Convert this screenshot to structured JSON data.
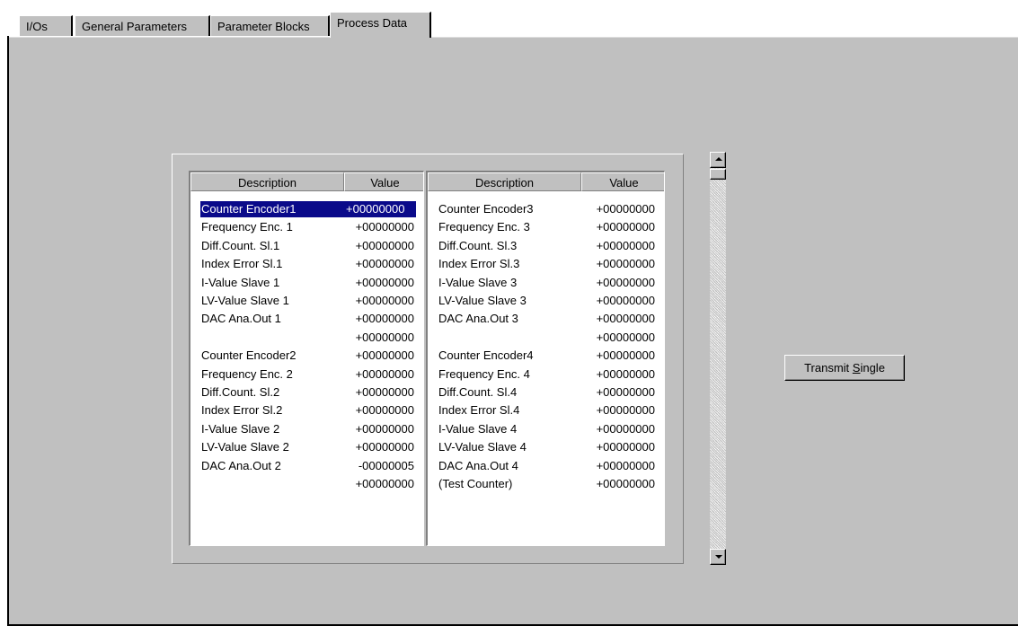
{
  "tabs": [
    {
      "label": "I/Os"
    },
    {
      "label": "General Parameters"
    },
    {
      "label": "Parameter Blocks"
    },
    {
      "label": "Process Data",
      "active": true
    }
  ],
  "left_table": {
    "headers": {
      "description": "Description",
      "value": "Value"
    },
    "rows": [
      {
        "description": "Counter Encoder1",
        "value": "+00000000",
        "selected": true
      },
      {
        "description": "Frequency Enc. 1",
        "value": "+00000000"
      },
      {
        "description": "Diff.Count. Sl.1",
        "value": "+00000000"
      },
      {
        "description": "Index Error Sl.1",
        "value": "+00000000"
      },
      {
        "description": "I-Value Slave 1",
        "value": "+00000000"
      },
      {
        "description": "LV-Value Slave 1",
        "value": "+00000000"
      },
      {
        "description": "DAC Ana.Out 1",
        "value": "+00000000"
      },
      {
        "description": "",
        "value": "+00000000"
      },
      {
        "description": "Counter Encoder2",
        "value": "+00000000"
      },
      {
        "description": "Frequency Enc. 2",
        "value": "+00000000"
      },
      {
        "description": "Diff.Count. Sl.2",
        "value": "+00000000"
      },
      {
        "description": "Index Error Sl.2",
        "value": "+00000000"
      },
      {
        "description": "I-Value Slave 2",
        "value": "+00000000"
      },
      {
        "description": "LV-Value Slave 2",
        "value": "+00000000"
      },
      {
        "description": "DAC Ana.Out 2",
        "value": "-00000005"
      },
      {
        "description": "",
        "value": "+00000000"
      }
    ]
  },
  "right_table": {
    "headers": {
      "description": "Description",
      "value": "Value"
    },
    "rows": [
      {
        "description": "Counter Encoder3",
        "value": "+00000000"
      },
      {
        "description": "Frequency Enc. 3",
        "value": "+00000000"
      },
      {
        "description": "Diff.Count. Sl.3",
        "value": "+00000000"
      },
      {
        "description": "Index Error Sl.3",
        "value": "+00000000"
      },
      {
        "description": "I-Value Slave 3",
        "value": "+00000000"
      },
      {
        "description": "LV-Value Slave 3",
        "value": "+00000000"
      },
      {
        "description": "DAC Ana.Out 3",
        "value": "+00000000"
      },
      {
        "description": "",
        "value": "+00000000"
      },
      {
        "description": "Counter Encoder4",
        "value": "+00000000"
      },
      {
        "description": "Frequency Enc. 4",
        "value": "+00000000"
      },
      {
        "description": "Diff.Count. Sl.4",
        "value": "+00000000"
      },
      {
        "description": "Index Error Sl.4",
        "value": "+00000000"
      },
      {
        "description": "I-Value Slave 4",
        "value": "+00000000"
      },
      {
        "description": "LV-Value Slave 4",
        "value": "+00000000"
      },
      {
        "description": "DAC Ana.Out 4",
        "value": "+00000000"
      },
      {
        "description": "(Test Counter)",
        "value": "+00000000"
      }
    ]
  },
  "transmit_button": {
    "label_pre": "Transmit ",
    "label_accel": "S",
    "label_post": "ingle"
  },
  "scrollbar": {
    "up_icon": "arrow-up-icon",
    "down_icon": "arrow-down-icon"
  },
  "colors": {
    "face": "#c0c0c0",
    "selection": "#0a0a8a",
    "list_bg": "#ffffff"
  }
}
